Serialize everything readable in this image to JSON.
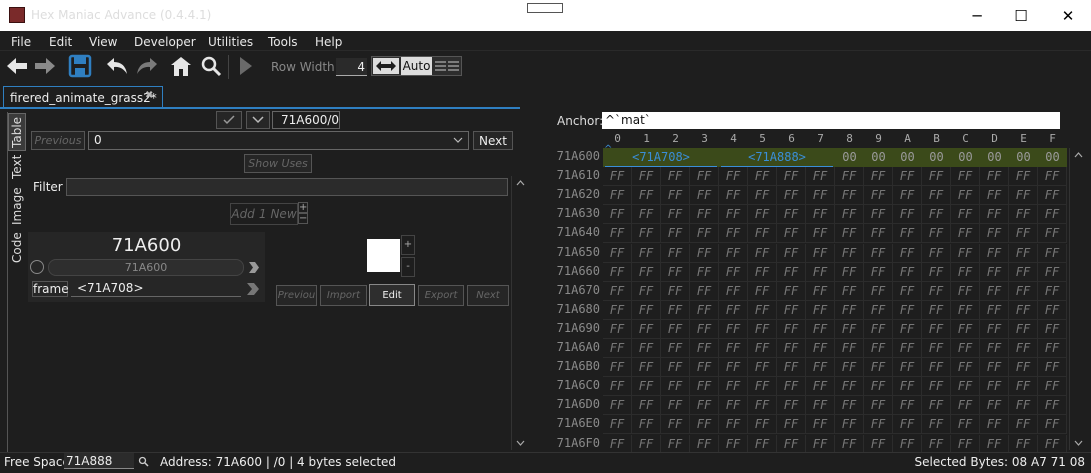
{
  "window": {
    "title": "Hex Maniac Advance (0.4.4.1)",
    "minimize": "─",
    "maximize": "☐",
    "close": "✕"
  },
  "menu": [
    "File",
    "Edit",
    "View",
    "Developer",
    "Utilities",
    "Tools",
    "Help"
  ],
  "toolbar": {
    "row_width_label": "Row Width:",
    "row_width_value": "4",
    "auto_label": "Auto"
  },
  "tab": {
    "label": "firered_animate_grass2*",
    "close": "✖"
  },
  "side_tabs": [
    "Table",
    "Text",
    "Image",
    "Code"
  ],
  "table_panel": {
    "address_field": "71A600/0",
    "previous_label": "Previous",
    "index_value": "0",
    "next_label": "Next",
    "show_uses_label": "Show Uses",
    "filter_label": "Filter",
    "add_label": "Add",
    "add_count": "1",
    "new_label": "New",
    "plus": "+",
    "minus": "−",
    "record_address_large": "71A600",
    "record_address_small": "71A600",
    "field_name": "frame",
    "field_value": "<71A708>",
    "image_plus": "+",
    "image_minus": "-",
    "image_buttons": [
      "Previou",
      "Import",
      "Edit",
      "Export",
      "Next"
    ]
  },
  "hex": {
    "anchor_label": "Anchor:",
    "anchor_value": "^`mat`",
    "columns": [
      "0",
      "1",
      "2",
      "3",
      "4",
      "5",
      "6",
      "7",
      "8",
      "9",
      "A",
      "B",
      "C",
      "D",
      "E",
      "F"
    ],
    "rows": [
      "71A600",
      "71A610",
      "71A620",
      "71A630",
      "71A640",
      "71A650",
      "71A660",
      "71A670",
      "71A680",
      "71A690",
      "71A6A0",
      "71A6B0",
      "71A6C0",
      "71A6D0",
      "71A6E0",
      "71A6F0"
    ],
    "pointer1": "<71A708>",
    "pointer2": "<71A888>",
    "anchor_caret": "^",
    "first_row_tail": [
      "00",
      "00",
      "00",
      "00",
      "00",
      "00",
      "00",
      "00"
    ],
    "fill_byte": "FF",
    "highlight_color": "#3b4a1a",
    "pointer_color": "#3a8ed8"
  },
  "status": {
    "free_space_label": "Free Space:",
    "free_space_value": "71A888",
    "address_info": "Address: 71A600 | /0 | 4 bytes selected",
    "selected_bytes": "Selected Bytes: 08 A7 71 08"
  }
}
